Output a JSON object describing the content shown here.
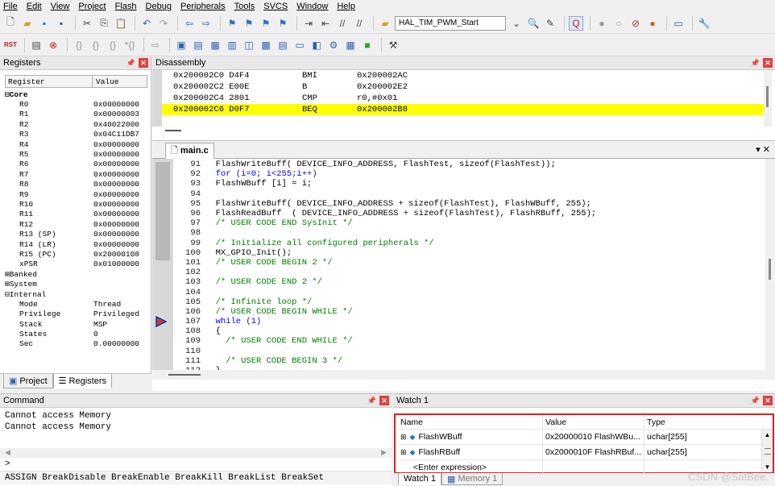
{
  "menu": [
    "File",
    "Edit",
    "View",
    "Project",
    "Flash",
    "Debug",
    "Peripherals",
    "Tools",
    "SVCS",
    "Window",
    "Help"
  ],
  "toolbar": {
    "target": "HAL_TIM_PWM_Start"
  },
  "registers": {
    "title": "Registers",
    "col_register": "Register",
    "col_value": "Value",
    "groups": {
      "core": "Core",
      "banked": "Banked",
      "system": "System",
      "internal": "Internal"
    },
    "core": [
      {
        "name": "R0",
        "value": "0x00000000"
      },
      {
        "name": "R1",
        "value": "0x00000003"
      },
      {
        "name": "R2",
        "value": "0x40022000"
      },
      {
        "name": "R3",
        "value": "0x04C11DB7"
      },
      {
        "name": "R4",
        "value": "0x00000000"
      },
      {
        "name": "R5",
        "value": "0x00000000"
      },
      {
        "name": "R6",
        "value": "0x00000000"
      },
      {
        "name": "R7",
        "value": "0x00000000"
      },
      {
        "name": "R8",
        "value": "0x00000000"
      },
      {
        "name": "R9",
        "value": "0x00000000"
      },
      {
        "name": "R10",
        "value": "0x00000000"
      },
      {
        "name": "R11",
        "value": "0x00000000"
      },
      {
        "name": "R12",
        "value": "0x00000000"
      },
      {
        "name": "R13 (SP)",
        "value": "0x00000000"
      },
      {
        "name": "R14 (LR)",
        "value": "0x00000000"
      },
      {
        "name": "R15 (PC)",
        "value": "0x20000108"
      },
      {
        "name": "xPSR",
        "value": "0x01000000"
      }
    ],
    "internal": [
      {
        "name": "Mode",
        "value": "Thread"
      },
      {
        "name": "Privilege",
        "value": "Privileged"
      },
      {
        "name": "Stack",
        "value": "MSP"
      },
      {
        "name": "States",
        "value": "0"
      },
      {
        "name": "Sec",
        "value": "0.00000000"
      }
    ],
    "tab_project": "Project",
    "tab_registers": "Registers"
  },
  "disassembly": {
    "title": "Disassembly",
    "rows": [
      {
        "addr": "0x200002C0 D4F4",
        "mn": "BMI",
        "op": "0x200002AC"
      },
      {
        "addr": "0x200002C2 E00E",
        "mn": "B",
        "op": "0x200002E2"
      },
      {
        "addr": "0x200002C4 2801",
        "mn": "CMP",
        "op": "r0,#0x01"
      },
      {
        "addr": "0x200002C6 D0F7",
        "mn": "BEQ",
        "op": "0x200002B8"
      }
    ]
  },
  "editor": {
    "tab": "main.c",
    "lines": [
      {
        "n": "91",
        "t": "  FlashWriteBuff( DEVICE_INFO_ADDRESS, FlashTest, sizeof(FlashTest));"
      },
      {
        "n": "92",
        "t": "  for (i=0; i<255;i++)"
      },
      {
        "n": "93",
        "t": "  FlashWBuff [i] = i;"
      },
      {
        "n": "94",
        "t": ""
      },
      {
        "n": "95",
        "t": "  FlashWriteBuff( DEVICE_INFO_ADDRESS + sizeof(FlashTest), FlashWBuff, 255);"
      },
      {
        "n": "96",
        "t": "  FlashReadBuff  ( DEVICE_INFO_ADDRESS + sizeof(FlashTest), FlashRBuff, 255);"
      },
      {
        "n": "97",
        "t": "  /* USER CODE END SysInit */"
      },
      {
        "n": "98",
        "t": ""
      },
      {
        "n": "99",
        "t": "  /* Initialize all configured peripherals */"
      },
      {
        "n": "100",
        "t": "  MX_GPIO_Init();"
      },
      {
        "n": "101",
        "t": "  /* USER CODE BEGIN 2 */"
      },
      {
        "n": "102",
        "t": ""
      },
      {
        "n": "103",
        "t": "  /* USER CODE END 2 */"
      },
      {
        "n": "104",
        "t": ""
      },
      {
        "n": "105",
        "t": "  /* Infinite loop */"
      },
      {
        "n": "106",
        "t": "  /* USER CODE BEGIN WHILE */"
      },
      {
        "n": "107",
        "t": "  while (1)"
      },
      {
        "n": "108",
        "t": "  {"
      },
      {
        "n": "109",
        "t": "    /* USER CODE END WHILE */"
      },
      {
        "n": "110",
        "t": ""
      },
      {
        "n": "111",
        "t": "    /* USER CODE BEGIN 3 */"
      },
      {
        "n": "112",
        "t": "  }"
      }
    ]
  },
  "command": {
    "title": "Command",
    "lines": [
      "Cannot access Memory",
      "Cannot access Memory"
    ],
    "prompt": ">",
    "help": "ASSIGN BreakDisable BreakEnable BreakKill BreakList BreakSet"
  },
  "watch": {
    "title": "Watch 1",
    "col_name": "Name",
    "col_value": "Value",
    "col_type": "Type",
    "rows": [
      {
        "name": "FlashWBuff",
        "value": "0x20000010 FlashWBu...",
        "type": "uchar[255]"
      },
      {
        "name": "FlashRBuff",
        "value": "0x2000010F FlashRBuf...",
        "type": "uchar[255]"
      }
    ],
    "enter": "<Enter expression>",
    "tab_watch": "Watch 1",
    "tab_memory": "Memory 1",
    "highlight_color": "#e02020"
  },
  "watermark": "CSDN @SatBee."
}
